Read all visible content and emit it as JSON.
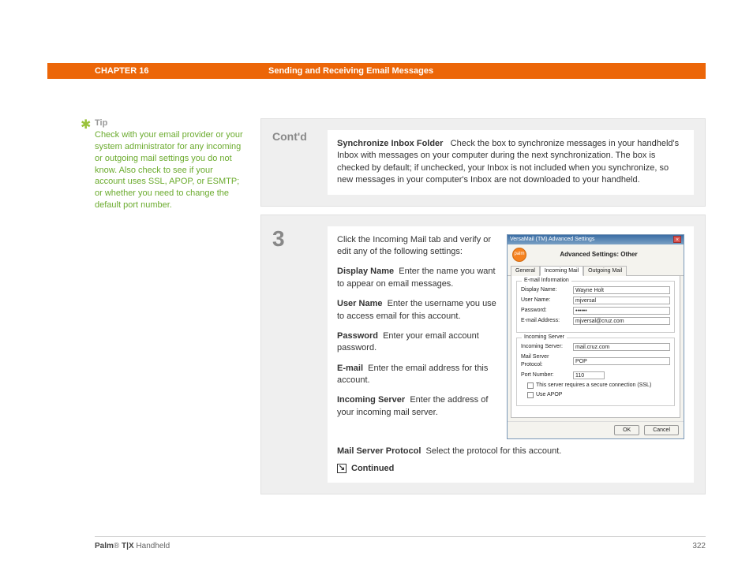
{
  "header": {
    "chapter": "CHAPTER 16",
    "title": "Sending and Receiving Email Messages"
  },
  "tip": {
    "heading": "Tip",
    "body": "Check with your email provider or your system administrator for any incoming or outgoing mail settings you do not know. Also check to see if your account uses SSL, APOP, or ESMTP; or whether you need to change the default port number."
  },
  "step_contd": {
    "label": "Cont'd",
    "sync_bold": "Synchronize Inbox Folder",
    "sync_text": "Check the box to synchronize messages in your handheld's Inbox with messages on your computer during the next synchronization. The box is checked by default; if unchecked, your Inbox is not included when you synchronize, so new messages in your computer's Inbox are not downloaded to your handheld."
  },
  "step3": {
    "num": "3",
    "intro": "Click the Incoming Mail tab and verify or edit any of the following settings:",
    "display_name_bold": "Display Name",
    "display_name_text": "Enter the name you want to appear on email messages.",
    "user_name_bold": "User Name",
    "user_name_text": "Enter the username you use to access email for this account.",
    "password_bold": "Password",
    "password_text": "Enter your email account password.",
    "email_bold": "E-mail",
    "email_text": "Enter the email address for this account.",
    "incoming_bold": "Incoming Server",
    "incoming_text": "Enter the address of your incoming mail server.",
    "protocol_bold": "Mail Server Protocol",
    "protocol_text": "Select the protocol for this account.",
    "continued": "Continued"
  },
  "dialog": {
    "titlebar": "VersaMail (TM) Advanced Settings",
    "heading": "Advanced Settings: Other",
    "tabs": {
      "general": "General",
      "incoming": "Incoming Mail",
      "outgoing": "Outgoing Mail"
    },
    "group_email": "E-mail Information",
    "group_server": "Incoming Server",
    "labels": {
      "display_name": "Display Name:",
      "user_name": "User Name:",
      "password": "Password:",
      "email": "E-mail Address:",
      "incoming_server": "Incoming Server:",
      "protocol": "Mail Server Protocol:",
      "port": "Port Number:"
    },
    "values": {
      "display_name": "Wayne Holt",
      "user_name": "mjversal",
      "password": "••••••",
      "email": "mjversal@cruz.com",
      "incoming_server": "mail.cruz.com",
      "protocol": "POP",
      "port": "110"
    },
    "check_ssl": "This server requires a secure connection (SSL)",
    "check_apop": "Use APOP",
    "ok": "OK",
    "cancel": "Cancel"
  },
  "footer": {
    "brand_bold": "Palm",
    "brand_reg": "®",
    "brand_model": " T|X",
    "brand_rest": " Handheld",
    "page": "322"
  }
}
